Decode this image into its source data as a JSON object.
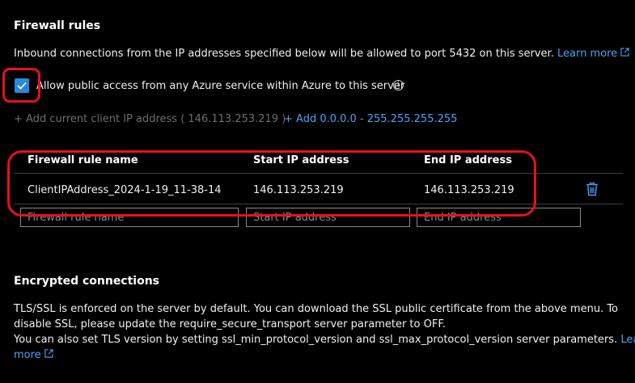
{
  "firewall": {
    "title": "Firewall rules",
    "description": "Inbound connections from the IP addresses specified below will be allowed to port 5432 on this server.",
    "learn_more": "Learn more",
    "allow_azure_label": "Allow public access from any Azure service within Azure to this server",
    "allow_azure_checked": true,
    "add_client_ip": "+ Add current client IP address ( 146.113.253.219 )",
    "add_range": "+ Add 0.0.0.0 - 255.255.255.255",
    "table": {
      "headers": [
        "Firewall rule name",
        "Start IP address",
        "End IP address"
      ],
      "rows": [
        {
          "name": "ClientIPAddress_2024-1-19_11-38-14",
          "start": "146.113.253.219",
          "end": "146.113.253.219"
        }
      ],
      "new_row_placeholders": [
        "Firewall rule name",
        "Start IP address",
        "End IP address"
      ]
    }
  },
  "encryption": {
    "title": "Encrypted connections",
    "line1": "TLS/SSL is enforced on the server by default. You can download the SSL public certificate from the above menu. To",
    "line2": "disable SSL, please update the require_secure_transport server parameter to OFF.",
    "line3": "You can also set TLS version by setting ssl_min_protocol_version and ssl_max_protocol_version server parameters.",
    "learn_more_part1": "Learn",
    "learn_more_part2": "more"
  },
  "icons": {
    "external_link": "external-link-icon",
    "info": "info-icon",
    "delete": "trash-icon",
    "check": "checkmark-icon"
  },
  "colors": {
    "background": "#000000",
    "link": "#4ea1f3",
    "checkbox": "#2b88d8",
    "annotation": "#e8101c"
  }
}
